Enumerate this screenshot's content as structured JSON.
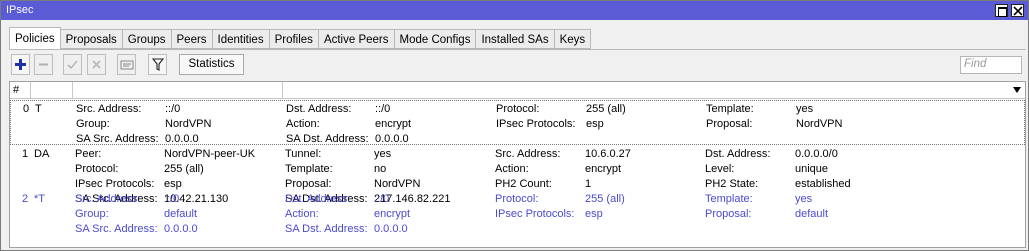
{
  "window": {
    "title": "IPsec"
  },
  "tabs": [
    "Policies",
    "Proposals",
    "Groups",
    "Peers",
    "Identities",
    "Profiles",
    "Active Peers",
    "Mode Configs",
    "Installed SAs",
    "Keys"
  ],
  "toolbar": {
    "add_icon": "plus-icon",
    "remove_icon": "minus-icon",
    "enable_icon": "check-icon",
    "disable_icon": "cross-icon",
    "comment_icon": "comment-icon",
    "filter_icon": "filter-icon",
    "statistics_label": "Statistics",
    "find_placeholder": "Find"
  },
  "table": {
    "header_hash": "#",
    "rows": [
      {
        "num": "0",
        "flags": "T",
        "c1": [
          [
            "Src. Address:",
            "::/0"
          ],
          [
            "Group:",
            "NordVPN"
          ],
          [
            "SA Src. Address:",
            "0.0.0.0"
          ]
        ],
        "c2": [
          [
            "Dst. Address:",
            "::/0"
          ],
          [
            "Action:",
            "encrypt"
          ],
          [
            "SA Dst. Address:",
            "0.0.0.0"
          ]
        ],
        "c3": [
          [
            "Protocol:",
            "255 (all)"
          ],
          [
            "IPsec Protocols:",
            "esp"
          ]
        ],
        "c4": [
          [
            "Template:",
            "yes"
          ],
          [
            "Proposal:",
            "NordVPN"
          ]
        ]
      },
      {
        "num": "1",
        "flags": "DA",
        "c1": [
          [
            "Peer:",
            "NordVPN-peer-UK"
          ],
          [
            "Protocol:",
            "255 (all)"
          ],
          [
            "IPsec Protocols:",
            "esp"
          ],
          [
            "SA Src. Address:",
            "10.42.21.130"
          ]
        ],
        "c2": [
          [
            "Tunnel:",
            "yes"
          ],
          [
            "Template:",
            "no"
          ],
          [
            "Proposal:",
            "NordVPN"
          ],
          [
            "SA Dst. Address:",
            "217.146.82.221"
          ]
        ],
        "c3": [
          [
            "Src. Address:",
            "10.6.0.27"
          ],
          [
            "Action:",
            "encrypt"
          ],
          [
            "PH2 Count:",
            "1"
          ]
        ],
        "c4": [
          [
            "Dst. Address:",
            "0.0.0.0/0"
          ],
          [
            "Level:",
            "unique"
          ],
          [
            "PH2 State:",
            "established"
          ]
        ]
      },
      {
        "num": "2",
        "flags": "*T",
        "c1": [
          [
            "Src. Address:",
            "::/0"
          ],
          [
            "Group:",
            "default"
          ],
          [
            "SA Src. Address:",
            "0.0.0.0"
          ]
        ],
        "c2": [
          [
            "Dst. Address:",
            "::/0"
          ],
          [
            "Action:",
            "encrypt"
          ],
          [
            "SA Dst. Address:",
            "0.0.0.0"
          ]
        ],
        "c3": [
          [
            "Protocol:",
            "255 (all)"
          ],
          [
            "IPsec Protocols:",
            "esp"
          ]
        ],
        "c4": [
          [
            "Template:",
            "yes"
          ],
          [
            "Proposal:",
            "default"
          ]
        ]
      }
    ]
  },
  "colors": {
    "titlebar": "#5b5bd6",
    "default_row_text": "#4a4ad0",
    "add_icon": "#1b2fa8"
  }
}
